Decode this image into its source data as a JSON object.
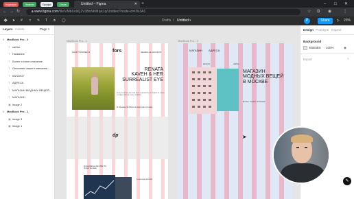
{
  "browser": {
    "bookmarks": [
      {
        "label": "Карьера",
        "color": "#e05050"
      },
      {
        "label": "Знания",
        "color": "#3aa55d"
      },
      {
        "label": "Профи",
        "color": "#e8edf2"
      },
      {
        "label": "Связь",
        "color": "#3aa55d"
      }
    ],
    "tab_title": "Untitled – Figma",
    "url_host": "www.figma.com",
    "url_path": "/file/VMbXo9Q2V3BnNKMIyk1q/Untitled?node-id=0%3A1",
    "window_controls": [
      "–",
      "□",
      "✕"
    ]
  },
  "figma_toolbar": {
    "breadcrumb_project": "Drafts",
    "separator": "/",
    "file_name": "Untitled",
    "share_label": "Share",
    "zoom": "23%",
    "avatar_initial": "P"
  },
  "left_panel": {
    "tabs": [
      "Layers",
      "Assets"
    ],
    "page_label": "Page 1",
    "layers": [
      {
        "label": "MacBook Pro - 2",
        "indent": 0,
        "icon": "#"
      },
      {
        "label": "сайты",
        "indent": 1,
        "icon": "T"
      },
      {
        "label": "Название",
        "indent": 1,
        "icon": "T"
      },
      {
        "label": "Более точное описание",
        "indent": 1,
        "icon": "T"
      },
      {
        "label": "Описание нашего магазина ...",
        "indent": 1,
        "icon": "T"
      },
      {
        "label": "КАТАЛОГ",
        "indent": 1,
        "icon": "T"
      },
      {
        "label": "АДРЕСА",
        "indent": 1,
        "icon": "T"
      },
      {
        "label": "МАГАЗИН МОДНЫХ ВЕЩЕЙ...",
        "indent": 1,
        "icon": "T"
      },
      {
        "label": "МАГАЗИН",
        "indent": 1,
        "icon": "T"
      },
      {
        "label": "image 2",
        "indent": 1,
        "icon": "▣"
      },
      {
        "label": "MacBook Pro - 1",
        "indent": 0,
        "icon": "#"
      },
      {
        "label": "image 3",
        "indent": 1,
        "icon": "▣"
      },
      {
        "label": "image 1",
        "indent": 1,
        "icon": "▣"
      }
    ]
  },
  "canvas": {
    "frame1_label": "MacBook Pro - 1",
    "frame2_label": "MacBook Pro - 2",
    "frame1": {
      "logo": "fors",
      "nav_left": "SHOP  ♥  WOMEN  ▾",
      "nav_right": "SEARCH  ●  ACCOUNT",
      "heading": [
        "RENATA",
        "KAVEH & HER",
        "SURREALIST EYE"
      ],
      "body_text": "Every luxurious item has been selected by our stylists to create a unique look for every occasion.",
      "caption": "Dr. Renata's GLOW as the Dark side of Cruella"
    },
    "frame2": {
      "logo": "dp"
    },
    "frame3": {
      "title_small": "Spotted Ribbed Tank Hits The Perfect Tee Mark",
      "side_text": "A new view of trends"
    },
    "frame4": {
      "nav": [
        "МАГАЗИН",
        "АДРЕСА"
      ],
      "sub_nav": [
        "каталог",
        "сайты"
      ],
      "heading": [
        "МАГАЗИН",
        "МОДНЫХ ВЕЩЕЙ",
        "В МОСКВЕ"
      ],
      "desc": "Более точное описание"
    }
  },
  "right_panel": {
    "tabs": [
      "Design",
      "Prototype",
      "Inspect"
    ],
    "section_background": "Background",
    "bg_hex": "E5E5E5",
    "bg_opacity": "100%",
    "section_export": "Export",
    "bg_swatch": "#e5e5e5"
  }
}
